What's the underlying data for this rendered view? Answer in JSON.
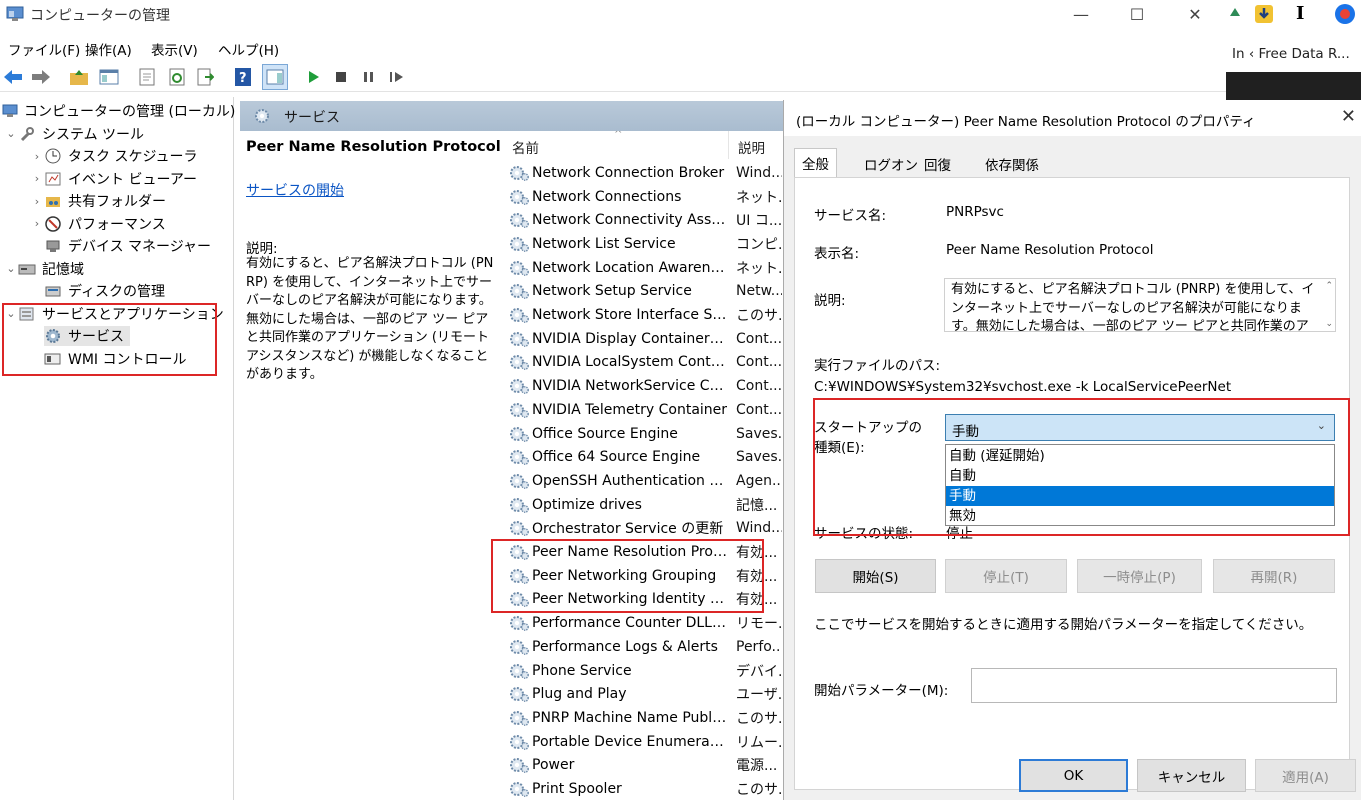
{
  "window": {
    "title": "コンピューターの管理",
    "minimize": "—",
    "maximize": "☐",
    "close": "✕"
  },
  "menu": [
    "ファイル(F)",
    "操作(A)",
    "表示(V)",
    "ヘルプ(H)"
  ],
  "browser": {
    "tab_text": "In ‹ Free Data R..."
  },
  "tree": {
    "root": "コンピューターの管理 (ローカル)",
    "system_tools": "システム ツール",
    "task_scheduler": "タスク スケジューラ",
    "event_viewer": "イベント ビューアー",
    "shared_folders": "共有フォルダー",
    "performance": "パフォーマンス",
    "device_manager": "デバイス マネージャー",
    "storage": "記憶域",
    "disk_management": "ディスクの管理",
    "services_apps": "サービスとアプリケーション",
    "services": "サービス",
    "wmi": "WMI コントロール"
  },
  "services_pane": {
    "header": "サービス",
    "selected_name": "Peer Name Resolution Protocol",
    "start_link": "サービスの開始",
    "desc_label": "説明:",
    "desc_text": "有効にすると、ピア名解決プロトコル (PNRP) を使用して、インターネット上でサーバーなしのピア名解決が可能になります。無効にした場合は、一部のピア ツー ピアと共同作業のアプリケーション (リモート アシスタンスなど) が機能しなくなることがあります。",
    "col_name": "名前",
    "col_desc": "説明",
    "rows": [
      {
        "name": "Network Connection Broker",
        "desc": "Wind..."
      },
      {
        "name": "Network Connections",
        "desc": "ネット..."
      },
      {
        "name": "Network Connectivity Assist...",
        "desc": "UI コ..."
      },
      {
        "name": "Network List Service",
        "desc": "コンピ..."
      },
      {
        "name": "Network Location Awareness",
        "desc": "ネット..."
      },
      {
        "name": "Network Setup Service",
        "desc": "Netw..."
      },
      {
        "name": "Network Store Interface Serv...",
        "desc": "このサ..."
      },
      {
        "name": "NVIDIA Display Container LS",
        "desc": "Cont..."
      },
      {
        "name": "NVIDIA LocalSystem Contain...",
        "desc": "Cont..."
      },
      {
        "name": "NVIDIA NetworkService Cont...",
        "desc": "Cont..."
      },
      {
        "name": "NVIDIA Telemetry Container",
        "desc": "Cont..."
      },
      {
        "name": "Office  Source Engine",
        "desc": "Saves..."
      },
      {
        "name": "Office 64 Source Engine",
        "desc": "Saves..."
      },
      {
        "name": "OpenSSH Authentication Ag...",
        "desc": "Agen..."
      },
      {
        "name": "Optimize drives",
        "desc": "記憶..."
      },
      {
        "name": "Orchestrator Service の更新",
        "desc": "Wind..."
      },
      {
        "name": "Peer Name Resolution Proto...",
        "desc": "有効..."
      },
      {
        "name": "Peer Networking Grouping",
        "desc": "有効..."
      },
      {
        "name": "Peer Networking Identity M...",
        "desc": "有効..."
      },
      {
        "name": "Performance Counter DLL H...",
        "desc": "リモー..."
      },
      {
        "name": "Performance Logs & Alerts",
        "desc": "Perfo..."
      },
      {
        "name": "Phone Service",
        "desc": "デバイ..."
      },
      {
        "name": "Plug and Play",
        "desc": "ユーザ..."
      },
      {
        "name": "PNRP Machine Name Public...",
        "desc": "このサ..."
      },
      {
        "name": "Portable Device Enumerator ...",
        "desc": "リムー..."
      },
      {
        "name": "Power",
        "desc": "電源..."
      },
      {
        "name": "Print Spooler",
        "desc": "このサ..."
      }
    ]
  },
  "dialog": {
    "title": "(ローカル コンピューター) Peer Name Resolution Protocol のプロパティ",
    "close": "✕",
    "tabs": [
      "全般",
      "ログオン",
      "回復",
      "依存関係"
    ],
    "service_name_label": "サービス名:",
    "service_name": "PNRPsvc",
    "display_name_label": "表示名:",
    "display_name": "Peer Name Resolution Protocol",
    "desc_label": "説明:",
    "desc_text": "有効にすると、ピア名解決プロトコル (PNRP) を使用して、インターネット上でサーバーなしのピア名解決が可能になります。無効にした場合は、一部のピア ツー ピアと共同作業のアプリケーション",
    "exe_label": "実行ファイルのパス:",
    "exe_path": "C:¥WINDOWS¥System32¥svchost.exe -k LocalServicePeerNet",
    "startup_label_1": "スタートアップの",
    "startup_label_2": "種類(E):",
    "startup_selected": "手動",
    "startup_options": [
      "自動 (遅延開始)",
      "自動",
      "手動",
      "無効"
    ],
    "status_label": "サービスの状態:",
    "status_value": "停止",
    "btn_start": "開始(S)",
    "btn_stop": "停止(T)",
    "btn_pause": "一時停止(P)",
    "btn_resume": "再開(R)",
    "param_hint": "ここでサービスを開始するときに適用する開始パラメーターを指定してください。",
    "param_label": "開始パラメーター(M):",
    "param_value": "",
    "btn_ok": "OK",
    "btn_cancel": "キャンセル",
    "btn_apply": "適用(A)"
  }
}
